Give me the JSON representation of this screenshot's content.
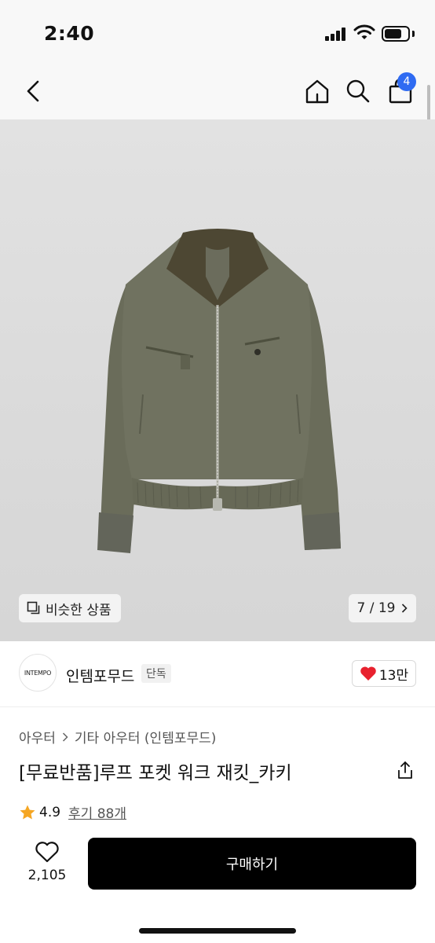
{
  "status": {
    "time": "2:40",
    "battery_level": 0.75
  },
  "nav": {
    "back_icon": "chevron-left-icon",
    "home_icon": "home-icon",
    "search_icon": "search-icon",
    "cart_icon": "shopping-bag-icon",
    "cart_count": "4"
  },
  "gallery": {
    "similar_label": "비슷한 상품",
    "counter": "7 / 19",
    "current_index": 7,
    "total": 19
  },
  "brand": {
    "logo_text": "INTEMPO",
    "name": "인템포무드",
    "badge": "단독",
    "likes": "13만"
  },
  "product": {
    "breadcrumb": [
      "아우터",
      "기타 아우터 (인템포무드)"
    ],
    "title": "[무료반품]루프 포켓 워크 재킷_카키",
    "rating": "4.9",
    "reviews": "후기 88개"
  },
  "bottom": {
    "wish_count": "2,105",
    "buy_label": "구매하기"
  },
  "colors": {
    "accent": "#2f6bf2",
    "like_red": "#e8212e",
    "star": "#f5a623",
    "jacket": "#6e705e",
    "collar": "#4b4532"
  }
}
